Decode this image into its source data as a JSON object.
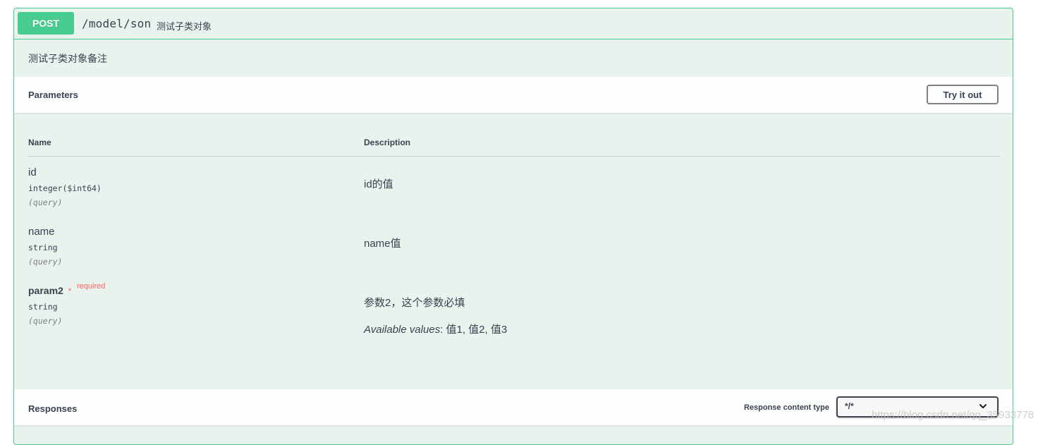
{
  "operation": {
    "method": "POST",
    "path": "/model/son",
    "summary": "测试子类对象",
    "description": "测试子类对象备注"
  },
  "parameters": {
    "title": "Parameters",
    "try_button": "Try it out",
    "columns": {
      "name": "Name",
      "description": "Description"
    },
    "rows": [
      {
        "name": "id",
        "type": "integer($int64)",
        "in": "(query)",
        "description": "id的值",
        "required": false
      },
      {
        "name": "name",
        "type": "string",
        "in": "(query)",
        "description": "name值",
        "required": false
      },
      {
        "name": "param2",
        "required_star": "*",
        "required_label": "required",
        "type": "string",
        "in": "(query)",
        "description": "参数2，这个参数必填",
        "available_label": "Available values",
        "available_values": ": 值1, 值2, 值3",
        "required": true
      }
    ]
  },
  "responses": {
    "title": "Responses",
    "content_type_label": "Response content type",
    "content_type_value": "*/*"
  },
  "watermark": "https://blog.csdn.net/qq_35933778",
  "colors": {
    "post_accent": "#49cc90",
    "post_background": "#e8f3ee",
    "required": "#ff6060",
    "text": "#3b4151"
  }
}
